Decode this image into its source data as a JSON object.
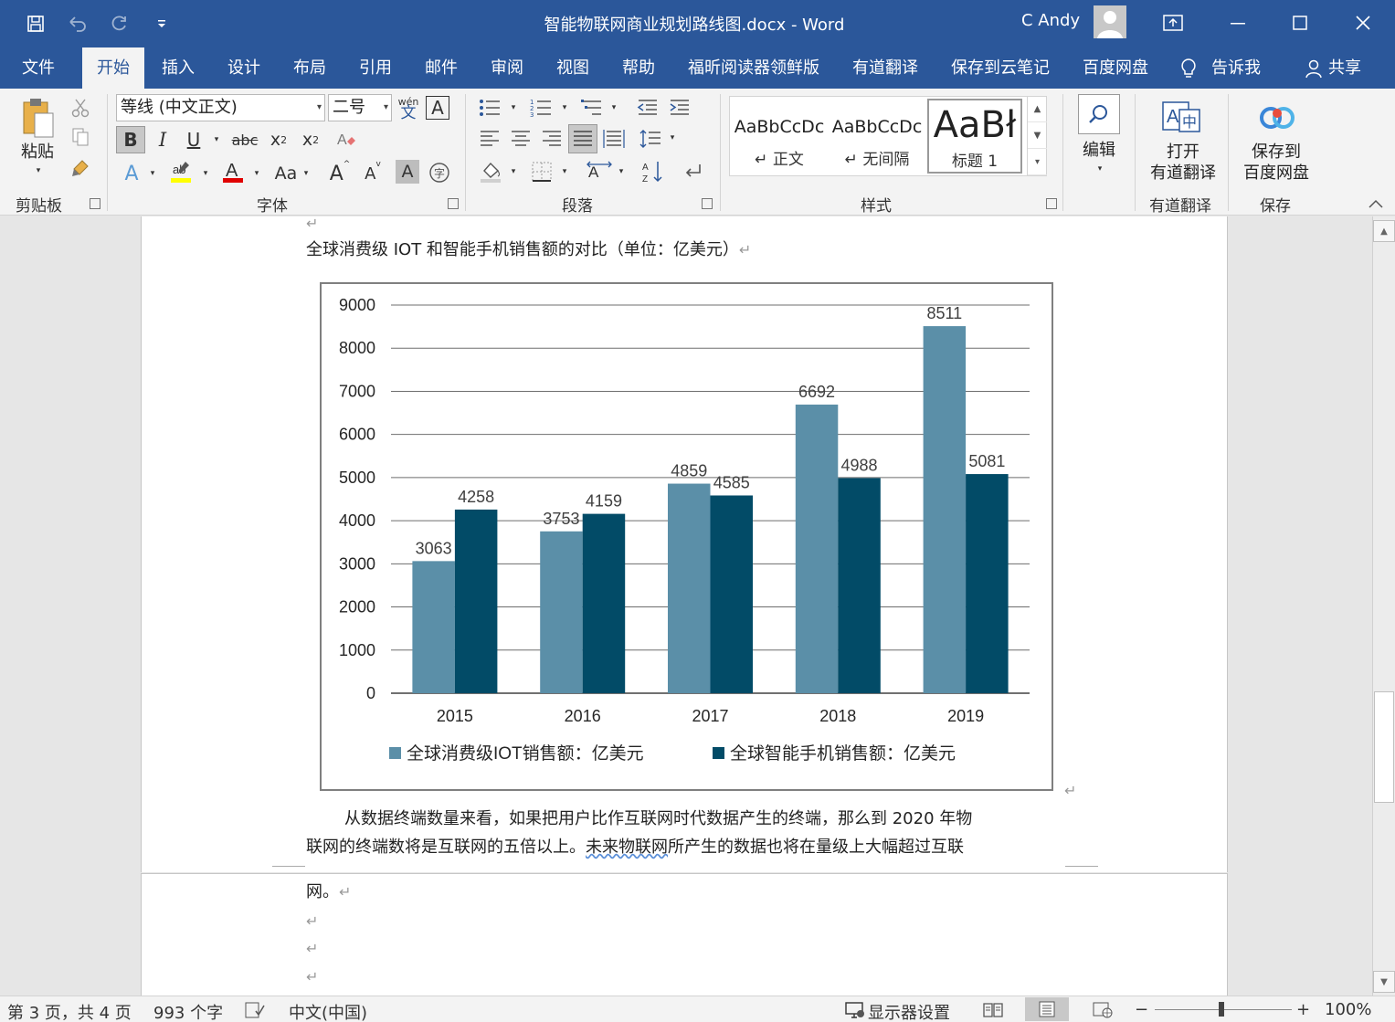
{
  "titlebar": {
    "doc_title": "智能物联网商业规划路线图.docx  -  Word",
    "user_name": "C Andy"
  },
  "menu": {
    "tabs": [
      "文件",
      "开始",
      "插入",
      "设计",
      "布局",
      "引用",
      "邮件",
      "审阅",
      "视图",
      "帮助",
      "福昕阅读器领鲜版",
      "有道翻译",
      "保存到云笔记",
      "百度网盘"
    ],
    "active_tab": "开始",
    "tell_me": "告诉我",
    "share": "共享"
  },
  "ribbon": {
    "clipboard": {
      "paste": "粘贴",
      "label": "剪贴板"
    },
    "font": {
      "font_name": "等线 (中文正文)",
      "font_size": "二号",
      "label": "字体",
      "pinyin_top": "wén",
      "pinyin_bottom": "文",
      "change_case": "Aa",
      "grow": "A",
      "shrink": "A"
    },
    "paragraph": {
      "label": "段落"
    },
    "styles": {
      "items": [
        {
          "sample": "AaBbCcDc",
          "name": "↵ 正文"
        },
        {
          "sample": "AaBbCcDc",
          "name": "↵ 无间隔"
        },
        {
          "sample": "AaBł",
          "name": "标题 1"
        }
      ],
      "label": "样式"
    },
    "editing": {
      "button": "编辑"
    },
    "youdao": {
      "button_line1": "打开",
      "button_line2": "有道翻译",
      "label": "有道翻译"
    },
    "baidu": {
      "button_line1": "保存到",
      "button_line2": "百度网盘",
      "label": "保存"
    }
  },
  "document": {
    "chart_caption": "全球消费级  IOT  和智能手机销售额的对比（单位：亿美元）",
    "body_line1": "从数据终端数量来看，如果把用户比作互联网时代数据产生的终端，那么到  2020 年物",
    "body_line2_a": "联网的终端数将是互联网的五倍以上。",
    "body_line2_b": "未来物联网",
    "body_line2_c": "所产生的数据也将在量级上大幅超过互联",
    "body_line3": "网。",
    "para_mark": "↵"
  },
  "chart_data": {
    "type": "bar",
    "categories": [
      "2015",
      "2016",
      "2017",
      "2018",
      "2019"
    ],
    "series": [
      {
        "name": "全球消费级IOT销售额：亿美元",
        "values": [
          3063,
          3753,
          4859,
          6692,
          8511
        ],
        "color": "#5b8fa8"
      },
      {
        "name": "全球智能手机销售额：亿美元",
        "values": [
          4258,
          4159,
          4585,
          4988,
          5081
        ],
        "color": "#024b67"
      }
    ],
    "y_ticks": [
      "0",
      "1000",
      "2000",
      "3000",
      "4000",
      "5000",
      "6000",
      "7000",
      "8000",
      "9000"
    ],
    "ylim": [
      0,
      9000
    ],
    "grid": true,
    "legend": "bottom",
    "title": "",
    "xlabel": "",
    "ylabel": ""
  },
  "statusbar": {
    "page": "第 3 页，共 4 页",
    "words": "993 个字",
    "language": "中文(中国)",
    "display_settings": "显示器设置",
    "zoom": "100%",
    "zoom_minus": "−",
    "zoom_plus": "+"
  },
  "colors": {
    "title_bar": "#2b579a",
    "ribbon_bg": "#f3f3f3",
    "iot_series": "#5b8fa8",
    "phone_series": "#024b67"
  }
}
